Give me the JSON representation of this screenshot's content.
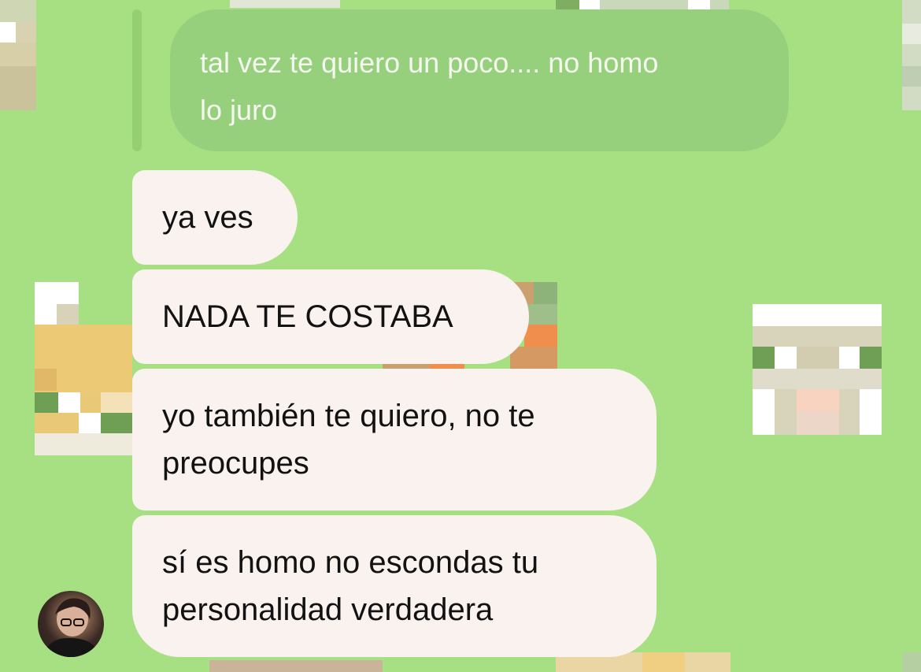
{
  "chat": {
    "quoted_message": {
      "text": "tal vez te quiero un poco.... no homo\nlo juro"
    },
    "messages": [
      {
        "text": "ya ves"
      },
      {
        "text": "NADA TE COSTABA"
      },
      {
        "text": "yo también te quiero, no te\npreocupes"
      },
      {
        "text": "sí es homo no escondas tu\npersonalidad verdadera"
      }
    ],
    "avatar_icon": "user-avatar-photo"
  },
  "colors": {
    "wallpaper": "#a6e082",
    "incoming_bubble": "#faf2ef",
    "quoted_bubble": "#96d07c",
    "quoted_text": "#f4f8ef",
    "message_text": "#121212"
  }
}
